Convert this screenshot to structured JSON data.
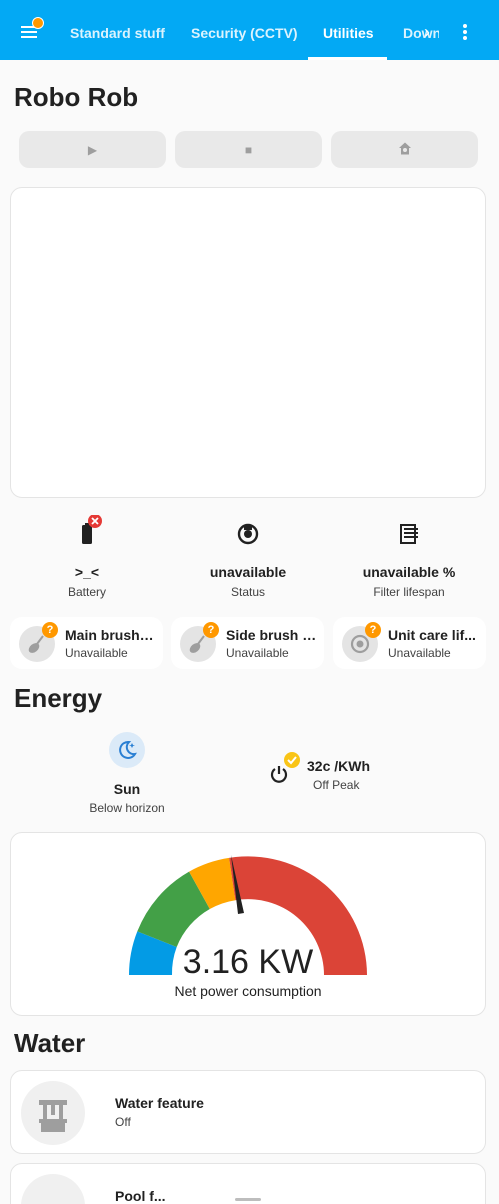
{
  "header": {
    "tabs": [
      {
        "label": "Standard stuff",
        "active": false
      },
      {
        "label": "Security (CCTV)",
        "active": false
      },
      {
        "label": "Utilities",
        "active": true
      },
      {
        "label": "Downloads",
        "active": false
      }
    ],
    "menu_icon": "hamburger-menu-icon",
    "notification_dot_color": "#ff9800",
    "more_icon": "more-vertical-icon",
    "scroll_icon": "chevron-right-icon",
    "bar_color": "#03a9f4"
  },
  "vacuum": {
    "title": "Robo Rob",
    "buttons": [
      {
        "icon": "play-icon",
        "glyph": "▶"
      },
      {
        "icon": "stop-icon",
        "glyph": "■"
      },
      {
        "icon": "home-icon",
        "glyph": "⌂"
      }
    ],
    "stats": [
      {
        "value": ">_<",
        "label": "Battery",
        "icon": "battery-alert-icon"
      },
      {
        "value": "unavailable",
        "label": "Status",
        "icon": "robot-vacuum-icon"
      },
      {
        "value": "unavailable %",
        "label": "Filter lifespan",
        "icon": "air-filter-icon"
      }
    ],
    "tiles": [
      {
        "name": "Main brush l...",
        "state": "Unavailable",
        "icon": "brush-icon",
        "badge": "?"
      },
      {
        "name": "Side brush li...",
        "state": "Unavailable",
        "icon": "brush-icon",
        "badge": "?"
      },
      {
        "name": "Unit care lif...",
        "state": "Unavailable",
        "icon": "robot-vacuum-icon",
        "badge": "?"
      }
    ]
  },
  "energy": {
    "title": "Energy",
    "sun": {
      "value": "Sun",
      "label": "Below horizon",
      "icon": "weather-night-icon"
    },
    "tariff": {
      "value": "32c /KWh",
      "label": "Off Peak",
      "icon": "power-icon",
      "badge_icon": "check-icon"
    },
    "gauge": {
      "value": 3.16,
      "display": "3.16 KW",
      "label": "Net power consumption",
      "segment_colors": [
        "#039be5",
        "#43a047",
        "#ffa600",
        "#db4437"
      ]
    }
  },
  "water": {
    "title": "Water",
    "items": [
      {
        "name": "Water feature",
        "state": "Off",
        "icon": "fountain-icon"
      },
      {
        "name": "Pool f...",
        "state": "",
        "icon": "pool-icon"
      }
    ]
  }
}
